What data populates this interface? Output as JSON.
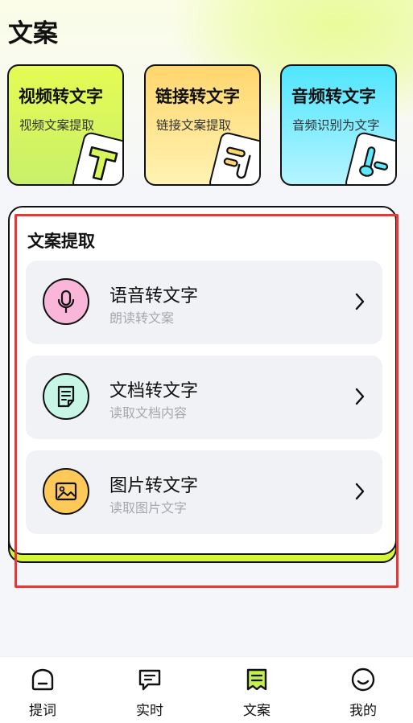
{
  "page": {
    "title": "文案"
  },
  "cards": [
    {
      "title": "视频转文字",
      "subtitle": "视频文案提取",
      "icon": "text-t-icon"
    },
    {
      "title": "链接转文字",
      "subtitle": "链接文案提取",
      "icon": "link-icon"
    },
    {
      "title": "音频转文字",
      "subtitle": "音频识别为文字",
      "icon": "music-note-icon"
    }
  ],
  "panel": {
    "title": "文案提取",
    "items": [
      {
        "title": "语音转文字",
        "subtitle": "朗读转文案",
        "icon": "microphone-icon",
        "color": "#f9b6d8"
      },
      {
        "title": "文档转文字",
        "subtitle": "读取文档内容",
        "icon": "document-icon",
        "color": "#c7f6e6"
      },
      {
        "title": "图片转文字",
        "subtitle": "读取图片文字",
        "icon": "image-icon",
        "color": "#ffc95a"
      }
    ]
  },
  "tabbar": {
    "items": [
      {
        "label": "提词",
        "icon": "home-icon"
      },
      {
        "label": "实时",
        "icon": "chat-icon"
      },
      {
        "label": "文案",
        "icon": "script-icon",
        "active": true,
        "active_color": "#c5f04a"
      },
      {
        "label": "我的",
        "icon": "smile-icon"
      }
    ]
  },
  "colors": {
    "highlight_border": "#e53935",
    "accent_lime": "#d4f53a"
  }
}
